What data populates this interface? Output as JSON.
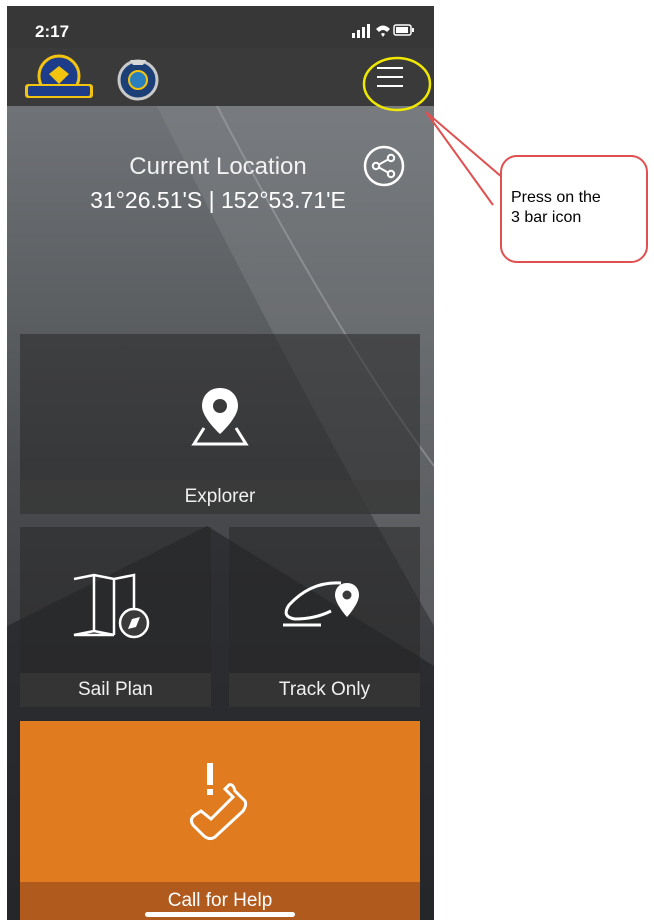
{
  "status_bar": {
    "time": "2:17"
  },
  "header": {
    "logo1": "coast-guard-logo",
    "logo2": "marine-rescue-emblem",
    "menu_icon": "menu-icon"
  },
  "location": {
    "title": "Current Location",
    "coords": "31°26.51'S | 152°53.71'E"
  },
  "tiles": {
    "explorer": "Explorer",
    "sail_plan": "Sail Plan",
    "track_only": "Track Only",
    "call_for_help": "Call for Help"
  },
  "annotation": {
    "text_line1": "Press on the",
    "text_line2": "3 bar icon"
  },
  "colors": {
    "accent": "#e07b1f",
    "highlight": "#f0e800",
    "callout_border": "#e05050"
  }
}
